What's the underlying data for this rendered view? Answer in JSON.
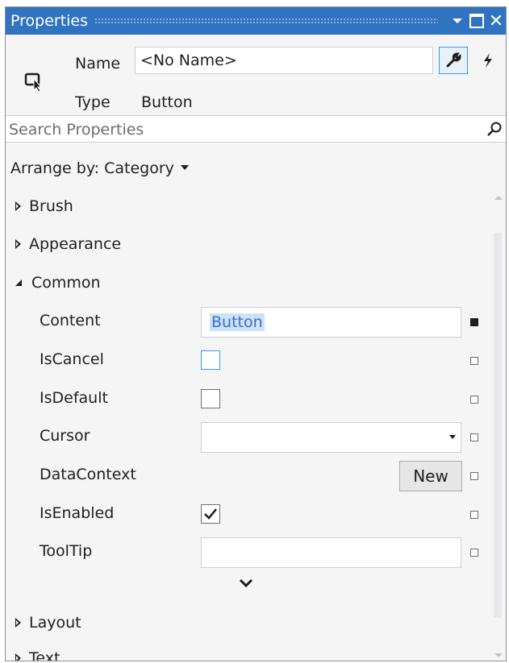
{
  "window": {
    "title": "Properties"
  },
  "header": {
    "name_label": "Name",
    "name_value": "<No Name>",
    "type_label": "Type",
    "type_value": "Button"
  },
  "search": {
    "placeholder": "Search Properties"
  },
  "arrange": {
    "label": "Arrange by: Category"
  },
  "categories": {
    "brush": "Brush",
    "appearance": "Appearance",
    "common": "Common",
    "layout": "Layout",
    "text": "Text"
  },
  "common_props": {
    "content": {
      "label": "Content",
      "value": "Button"
    },
    "is_cancel": {
      "label": "IsCancel",
      "checked": false
    },
    "is_default": {
      "label": "IsDefault",
      "checked": false
    },
    "cursor": {
      "label": "Cursor",
      "value": ""
    },
    "data_context": {
      "label": "DataContext",
      "button": "New"
    },
    "is_enabled": {
      "label": "IsEnabled",
      "checked": true
    },
    "tooltip": {
      "label": "ToolTip",
      "value": ""
    }
  },
  "icons": {
    "selection": "selection-cursor-icon",
    "properties": "wrench-icon",
    "events": "lightning-icon",
    "search": "magnifier-icon",
    "expand_more": "chevron-down-icon"
  },
  "colors": {
    "title_bar": "#3073c0",
    "selection_highlight": "#cbe1f7",
    "focus_border": "#3399ff"
  }
}
